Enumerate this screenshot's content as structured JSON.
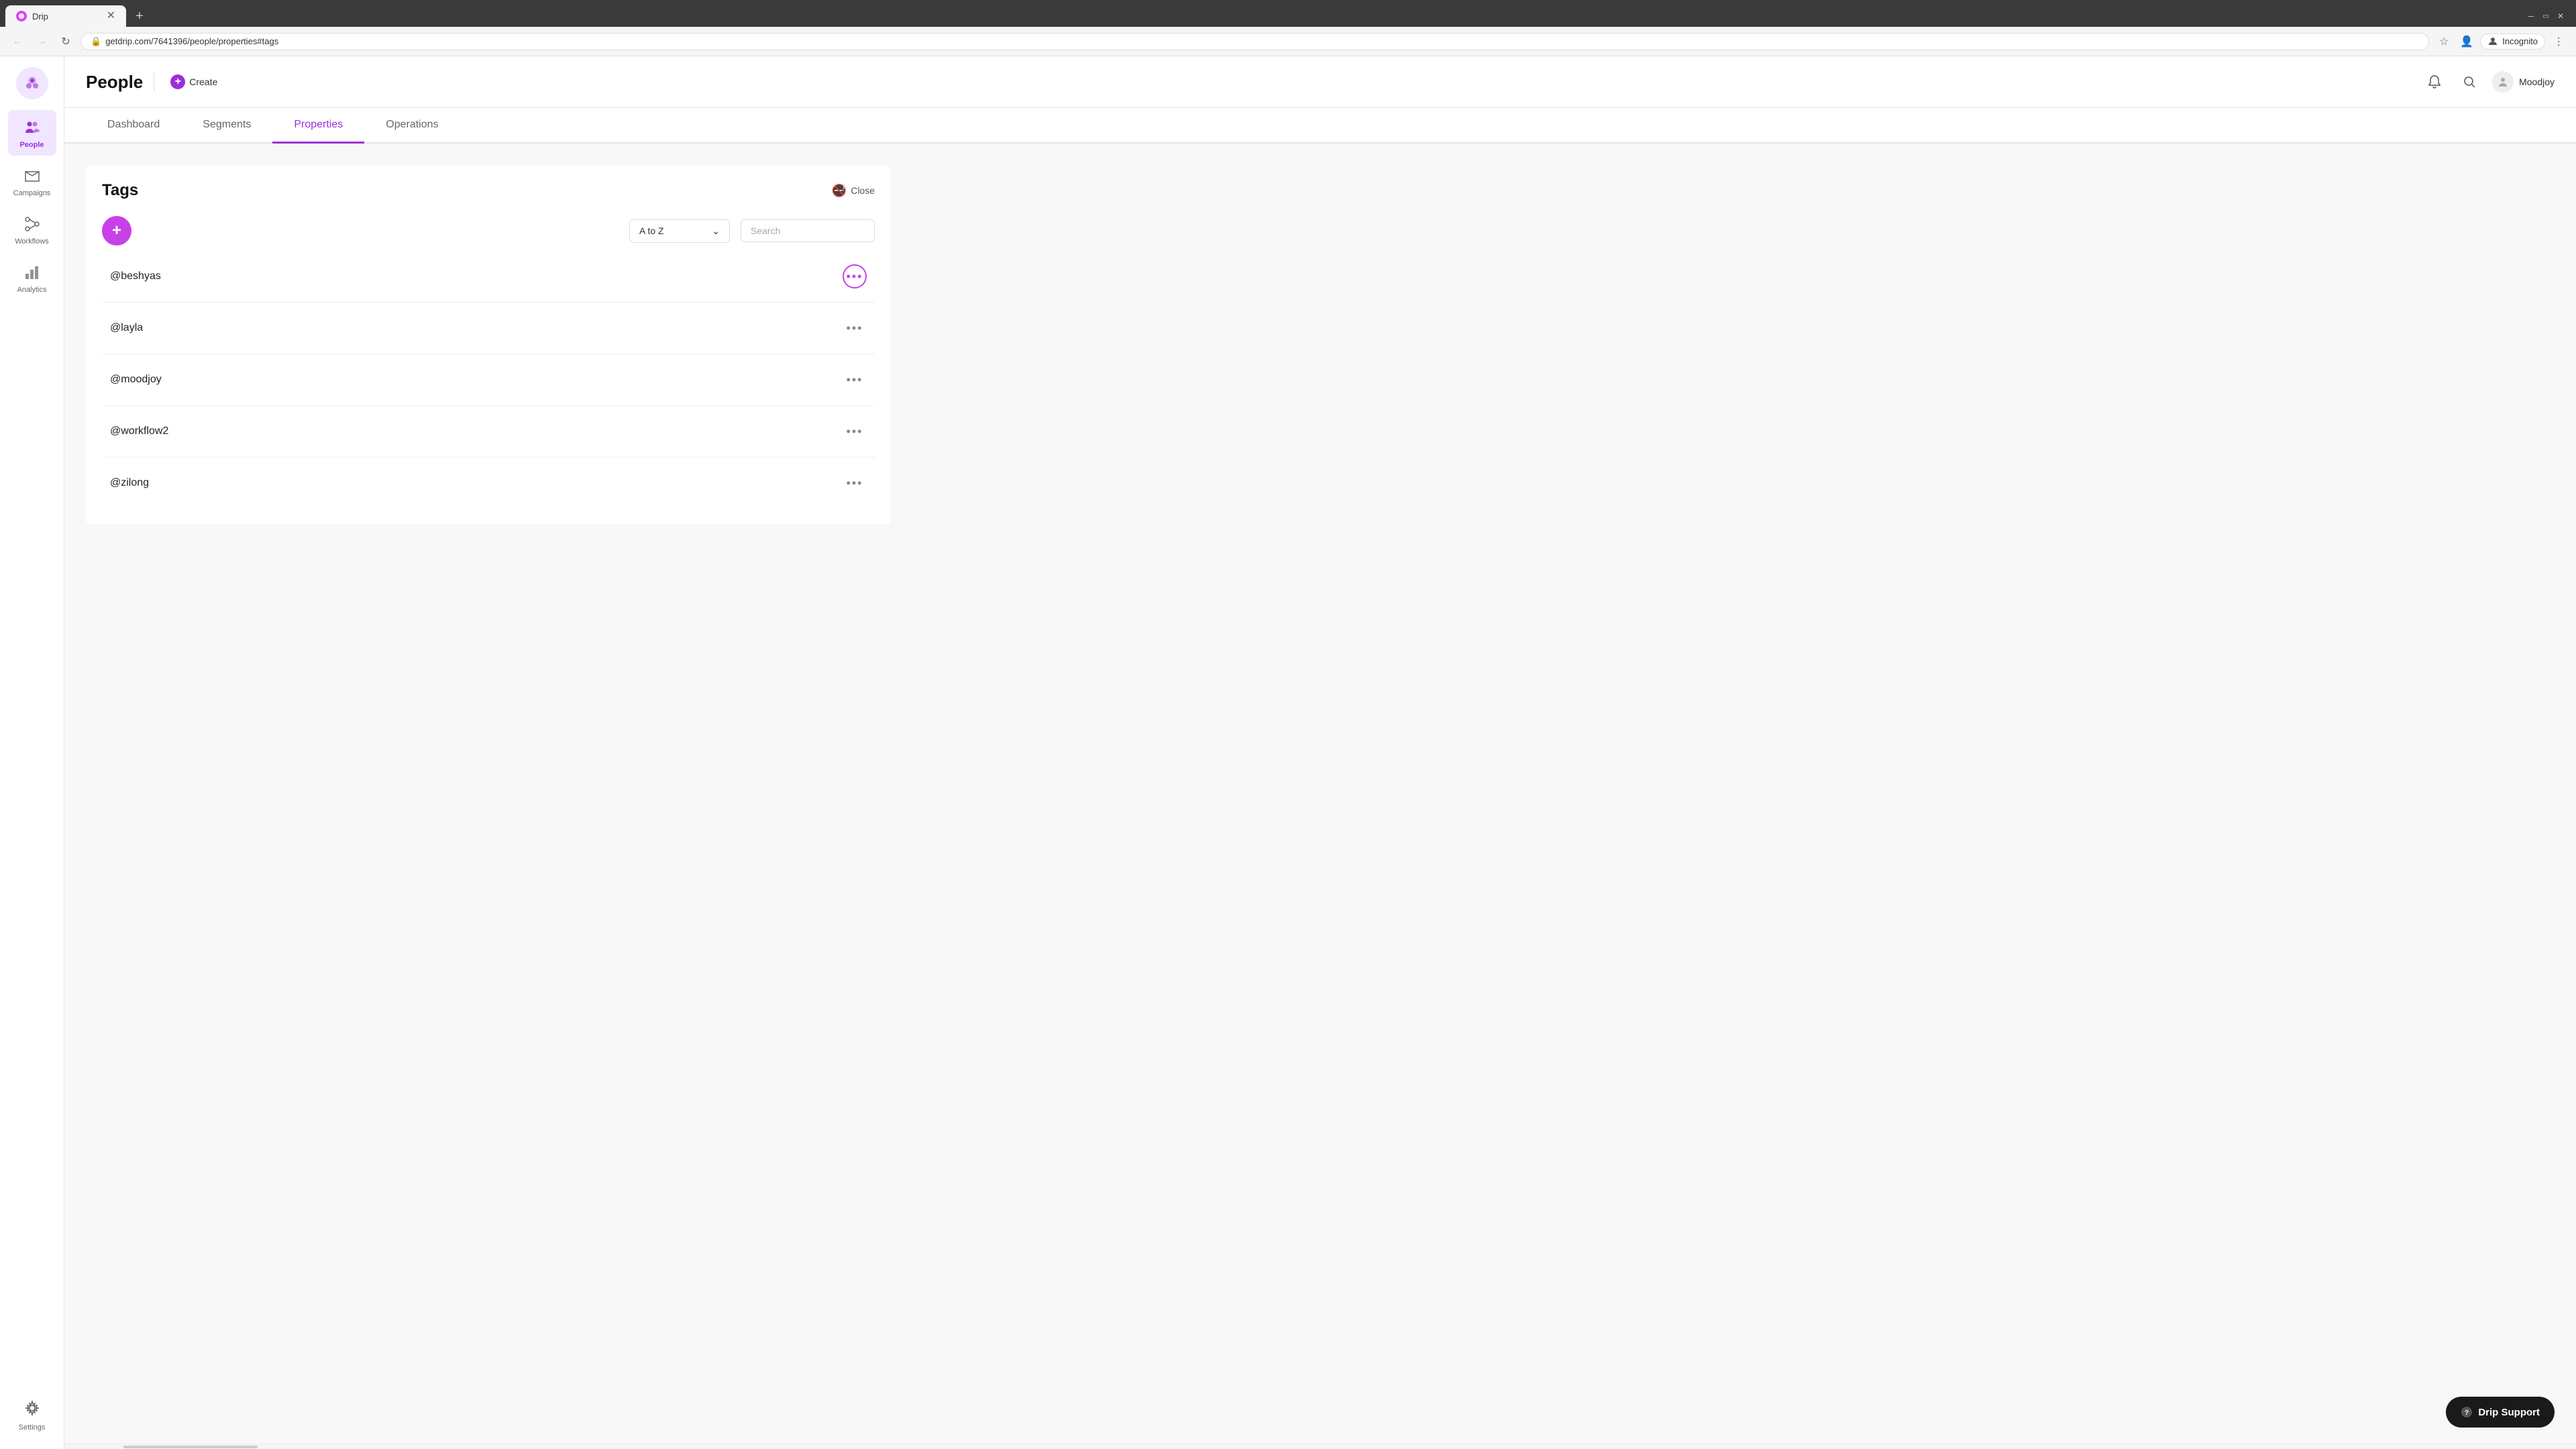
{
  "browser": {
    "tab_title": "Drip",
    "url": "getdrip.com/7641396/people/properties#tags",
    "tab_new_label": "+",
    "incognito_label": "Incognito"
  },
  "header": {
    "page_title": "People",
    "create_label": "Create",
    "user_name": "Moodjoy"
  },
  "tabs": [
    {
      "id": "dashboard",
      "label": "Dashboard",
      "active": false
    },
    {
      "id": "segments",
      "label": "Segments",
      "active": false
    },
    {
      "id": "properties",
      "label": "Properties",
      "active": true
    },
    {
      "id": "operations",
      "label": "Operations",
      "active": false
    }
  ],
  "sidebar": {
    "items": [
      {
        "id": "people",
        "label": "People",
        "active": true
      },
      {
        "id": "campaigns",
        "label": "Campaigns",
        "active": false
      },
      {
        "id": "workflows",
        "label": "Workflows",
        "active": false
      },
      {
        "id": "analytics",
        "label": "Analytics",
        "active": false
      }
    ],
    "settings_label": "Settings"
  },
  "tags_panel": {
    "title": "Tags",
    "close_label": "Close",
    "sort_label": "A to Z",
    "search_placeholder": "Search",
    "add_button_label": "+",
    "tags": [
      {
        "id": "beshyas",
        "name": "@beshyas",
        "menu_active": true
      },
      {
        "id": "layla",
        "name": "@layla",
        "menu_active": false
      },
      {
        "id": "moodjoy",
        "name": "@moodjoy",
        "menu_active": false
      },
      {
        "id": "workflow2",
        "name": "@workflow2",
        "menu_active": false
      },
      {
        "id": "zilong",
        "name": "@zilong",
        "menu_active": false
      }
    ]
  },
  "drip_support": {
    "label": "Drip Support"
  },
  "colors": {
    "accent": "#9b30d9",
    "accent_bright": "#c840e8",
    "dark": "#1a1a1a"
  }
}
